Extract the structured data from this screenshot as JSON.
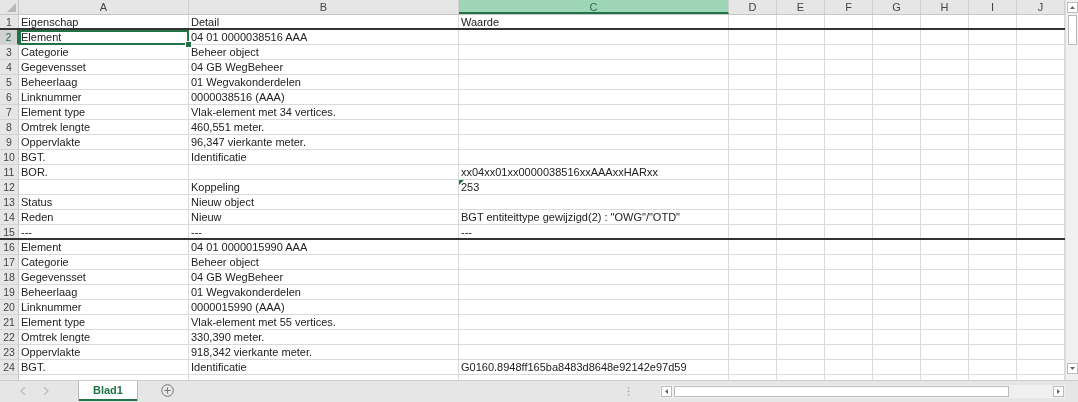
{
  "columns": [
    {
      "label": "A",
      "selected": false
    },
    {
      "label": "B",
      "selected": false
    },
    {
      "label": "C",
      "selected": true
    },
    {
      "label": "D",
      "selected": false
    },
    {
      "label": "E",
      "selected": false
    },
    {
      "label": "F",
      "selected": false
    },
    {
      "label": "G",
      "selected": false
    },
    {
      "label": "H",
      "selected": false
    },
    {
      "label": "I",
      "selected": false
    },
    {
      "label": "J",
      "selected": false
    }
  ],
  "rows": [
    {
      "number": "1",
      "a": "Eigenschap",
      "b": "Detail",
      "c": "Waarde",
      "selected": false,
      "rule_below": true,
      "error_mark": false
    },
    {
      "number": "2",
      "a": "Element",
      "b": "04 01 0000038516 AAA",
      "selected": true,
      "rule_below": false,
      "error_mark": false
    },
    {
      "number": "3",
      "a": "Categorie",
      "b": "Beheer object",
      "selected": false,
      "rule_below": false,
      "error_mark": false
    },
    {
      "number": "4",
      "a": "Gegevensset",
      "b": "04 GB WegBeheer",
      "selected": false,
      "rule_below": false,
      "error_mark": false
    },
    {
      "number": "5",
      "a": "Beheerlaag",
      "b": "01 Wegvakonderdelen",
      "selected": false,
      "rule_below": false,
      "error_mark": false
    },
    {
      "number": "6",
      "a": "Linknummer",
      "b": "0000038516 (AAA)",
      "selected": false,
      "rule_below": false,
      "error_mark": false
    },
    {
      "number": "7",
      "a": "Element type",
      "b": "Vlak-element met 34 vertices.",
      "selected": false,
      "rule_below": false,
      "error_mark": false
    },
    {
      "number": "8",
      "a": "Omtrek lengte",
      "b": "460,551 meter.",
      "selected": false,
      "rule_below": false,
      "error_mark": false
    },
    {
      "number": "9",
      "a": "Oppervlakte",
      "b": "96,347 vierkante meter.",
      "selected": false,
      "rule_below": false,
      "error_mark": false
    },
    {
      "number": "10",
      "a": "BGT.",
      "b": "Identificatie",
      "selected": false,
      "rule_below": false,
      "error_mark": false
    },
    {
      "number": "11",
      "a": "BOR.",
      "c": "xx04xx01xx0000038516xxAAAxxHARxx",
      "selected": false,
      "rule_below": false,
      "error_mark": false
    },
    {
      "number": "12",
      "b": "Koppeling",
      "c": "253",
      "selected": false,
      "rule_below": false,
      "error_mark": true
    },
    {
      "number": "13",
      "a": "Status",
      "b": "Nieuw object",
      "selected": false,
      "rule_below": false,
      "error_mark": false
    },
    {
      "number": "14",
      "a": "Reden",
      "b": "Nieuw",
      "c": "BGT entiteittype gewijzigd(2) : \"OWG\"/\"OTD\"",
      "selected": false,
      "rule_below": false,
      "error_mark": false
    },
    {
      "number": "15",
      "a": "---",
      "b": "---",
      "c": "---",
      "selected": false,
      "rule_below": true,
      "error_mark": false
    },
    {
      "number": "16",
      "a": "Element",
      "b": "04 01 0000015990 AAA",
      "selected": false,
      "rule_below": false,
      "error_mark": false
    },
    {
      "number": "17",
      "a": "Categorie",
      "b": "Beheer object",
      "selected": false,
      "rule_below": false,
      "error_mark": false
    },
    {
      "number": "18",
      "a": "Gegevensset",
      "b": "04 GB WegBeheer",
      "selected": false,
      "rule_below": false,
      "error_mark": false
    },
    {
      "number": "19",
      "a": "Beheerlaag",
      "b": "01 Wegvakonderdelen",
      "selected": false,
      "rule_below": false,
      "error_mark": false
    },
    {
      "number": "20",
      "a": "Linknummer",
      "b": "0000015990 (AAA)",
      "selected": false,
      "rule_below": false,
      "error_mark": false
    },
    {
      "number": "21",
      "a": "Element type",
      "b": "Vlak-element met 55 vertices.",
      "selected": false,
      "rule_below": false,
      "error_mark": false
    },
    {
      "number": "22",
      "a": "Omtrek lengte",
      "b": "330,390 meter.",
      "selected": false,
      "rule_below": false,
      "error_mark": false
    },
    {
      "number": "23",
      "a": "Oppervlakte",
      "b": "918,342 vierkante meter.",
      "selected": false,
      "rule_below": false,
      "error_mark": false
    },
    {
      "number": "24",
      "a": "BGT.",
      "b": "Identificatie",
      "c": "G0160.8948ff165ba8483d8648e92142e97d59",
      "selected": false,
      "rule_below": false,
      "error_mark": false
    }
  ],
  "sheet_tabs": [
    {
      "label": "Blad1",
      "selected": true
    }
  ]
}
